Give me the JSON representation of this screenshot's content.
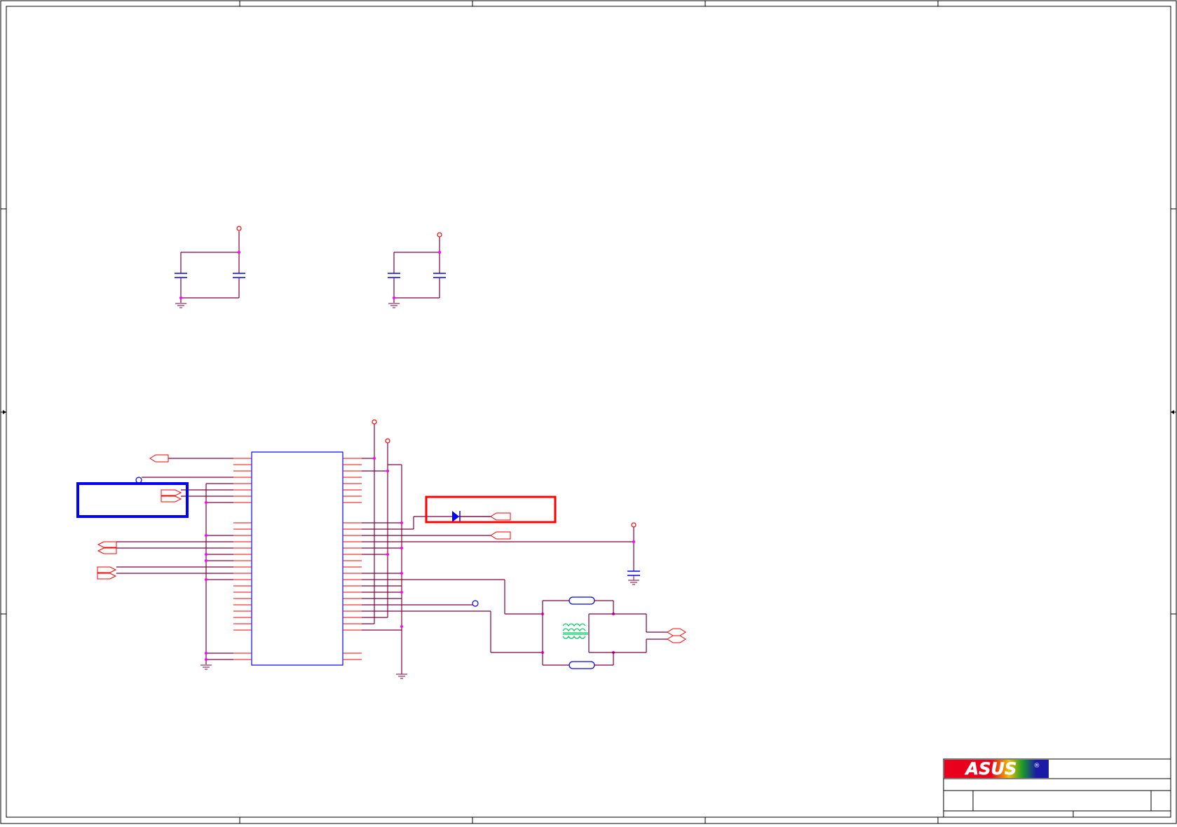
{
  "title_block": {
    "logo_text": "ASUS",
    "registered_mark": "®"
  },
  "colors": {
    "frame": "#000000",
    "wire": "#800040",
    "pin": "#ff0000",
    "junction": "#ff00ff",
    "component": "#0000ff",
    "highlight_blue": "#0000ff",
    "highlight_red": "#ff0000",
    "transformer": "#00cc66",
    "logo_red": "#e8001c",
    "logo_blue": "#1a1aa6"
  },
  "icons": {
    "ground": "ground-icon",
    "power": "power-port-icon",
    "capacitor": "capacitor-icon",
    "diode": "diode-icon",
    "transformer": "transformer-icon"
  }
}
